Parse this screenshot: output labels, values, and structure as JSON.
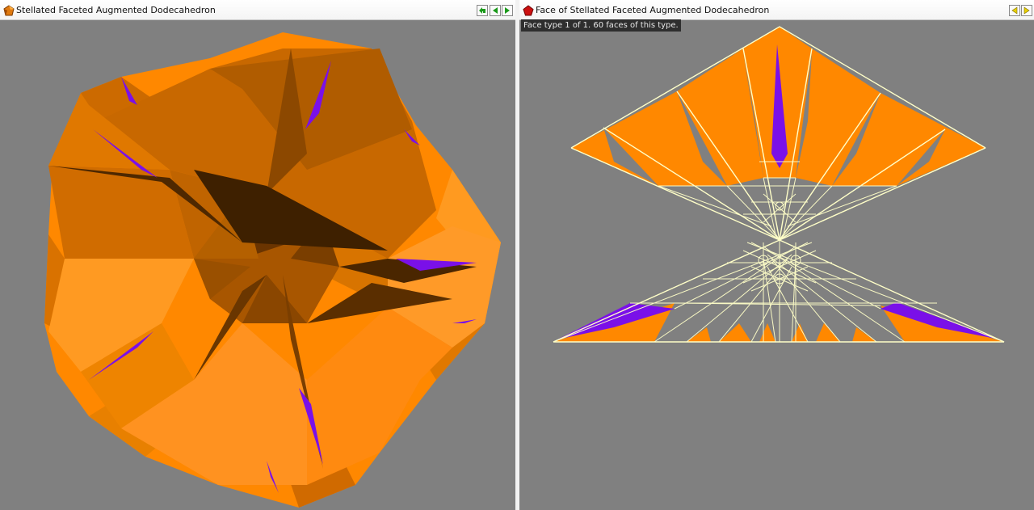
{
  "left_window": {
    "title": "Stellated Faceted Augmented Dodecahedron",
    "icon": "polyhedron-app-icon",
    "buttons": [
      "restore-icon",
      "previous-arrow-icon",
      "next-arrow-icon"
    ]
  },
  "right_window": {
    "title": "Face of Stellated Faceted Augmented Dodecahedron",
    "icon": "pentagon-icon",
    "info": "Face type 1 of 1.  60 faces of this type.",
    "buttons": [
      "previous-arrow-icon",
      "next-arrow-icon"
    ]
  },
  "colors": {
    "background": "#808080",
    "face_orange": "#ff8800",
    "face_purple": "#7a10e8",
    "edge_lines": "#ffffc8",
    "arrow_green": "#1a9a1a",
    "arrow_yellow": "#e8d000",
    "pentagon_red": "#cc1010"
  }
}
